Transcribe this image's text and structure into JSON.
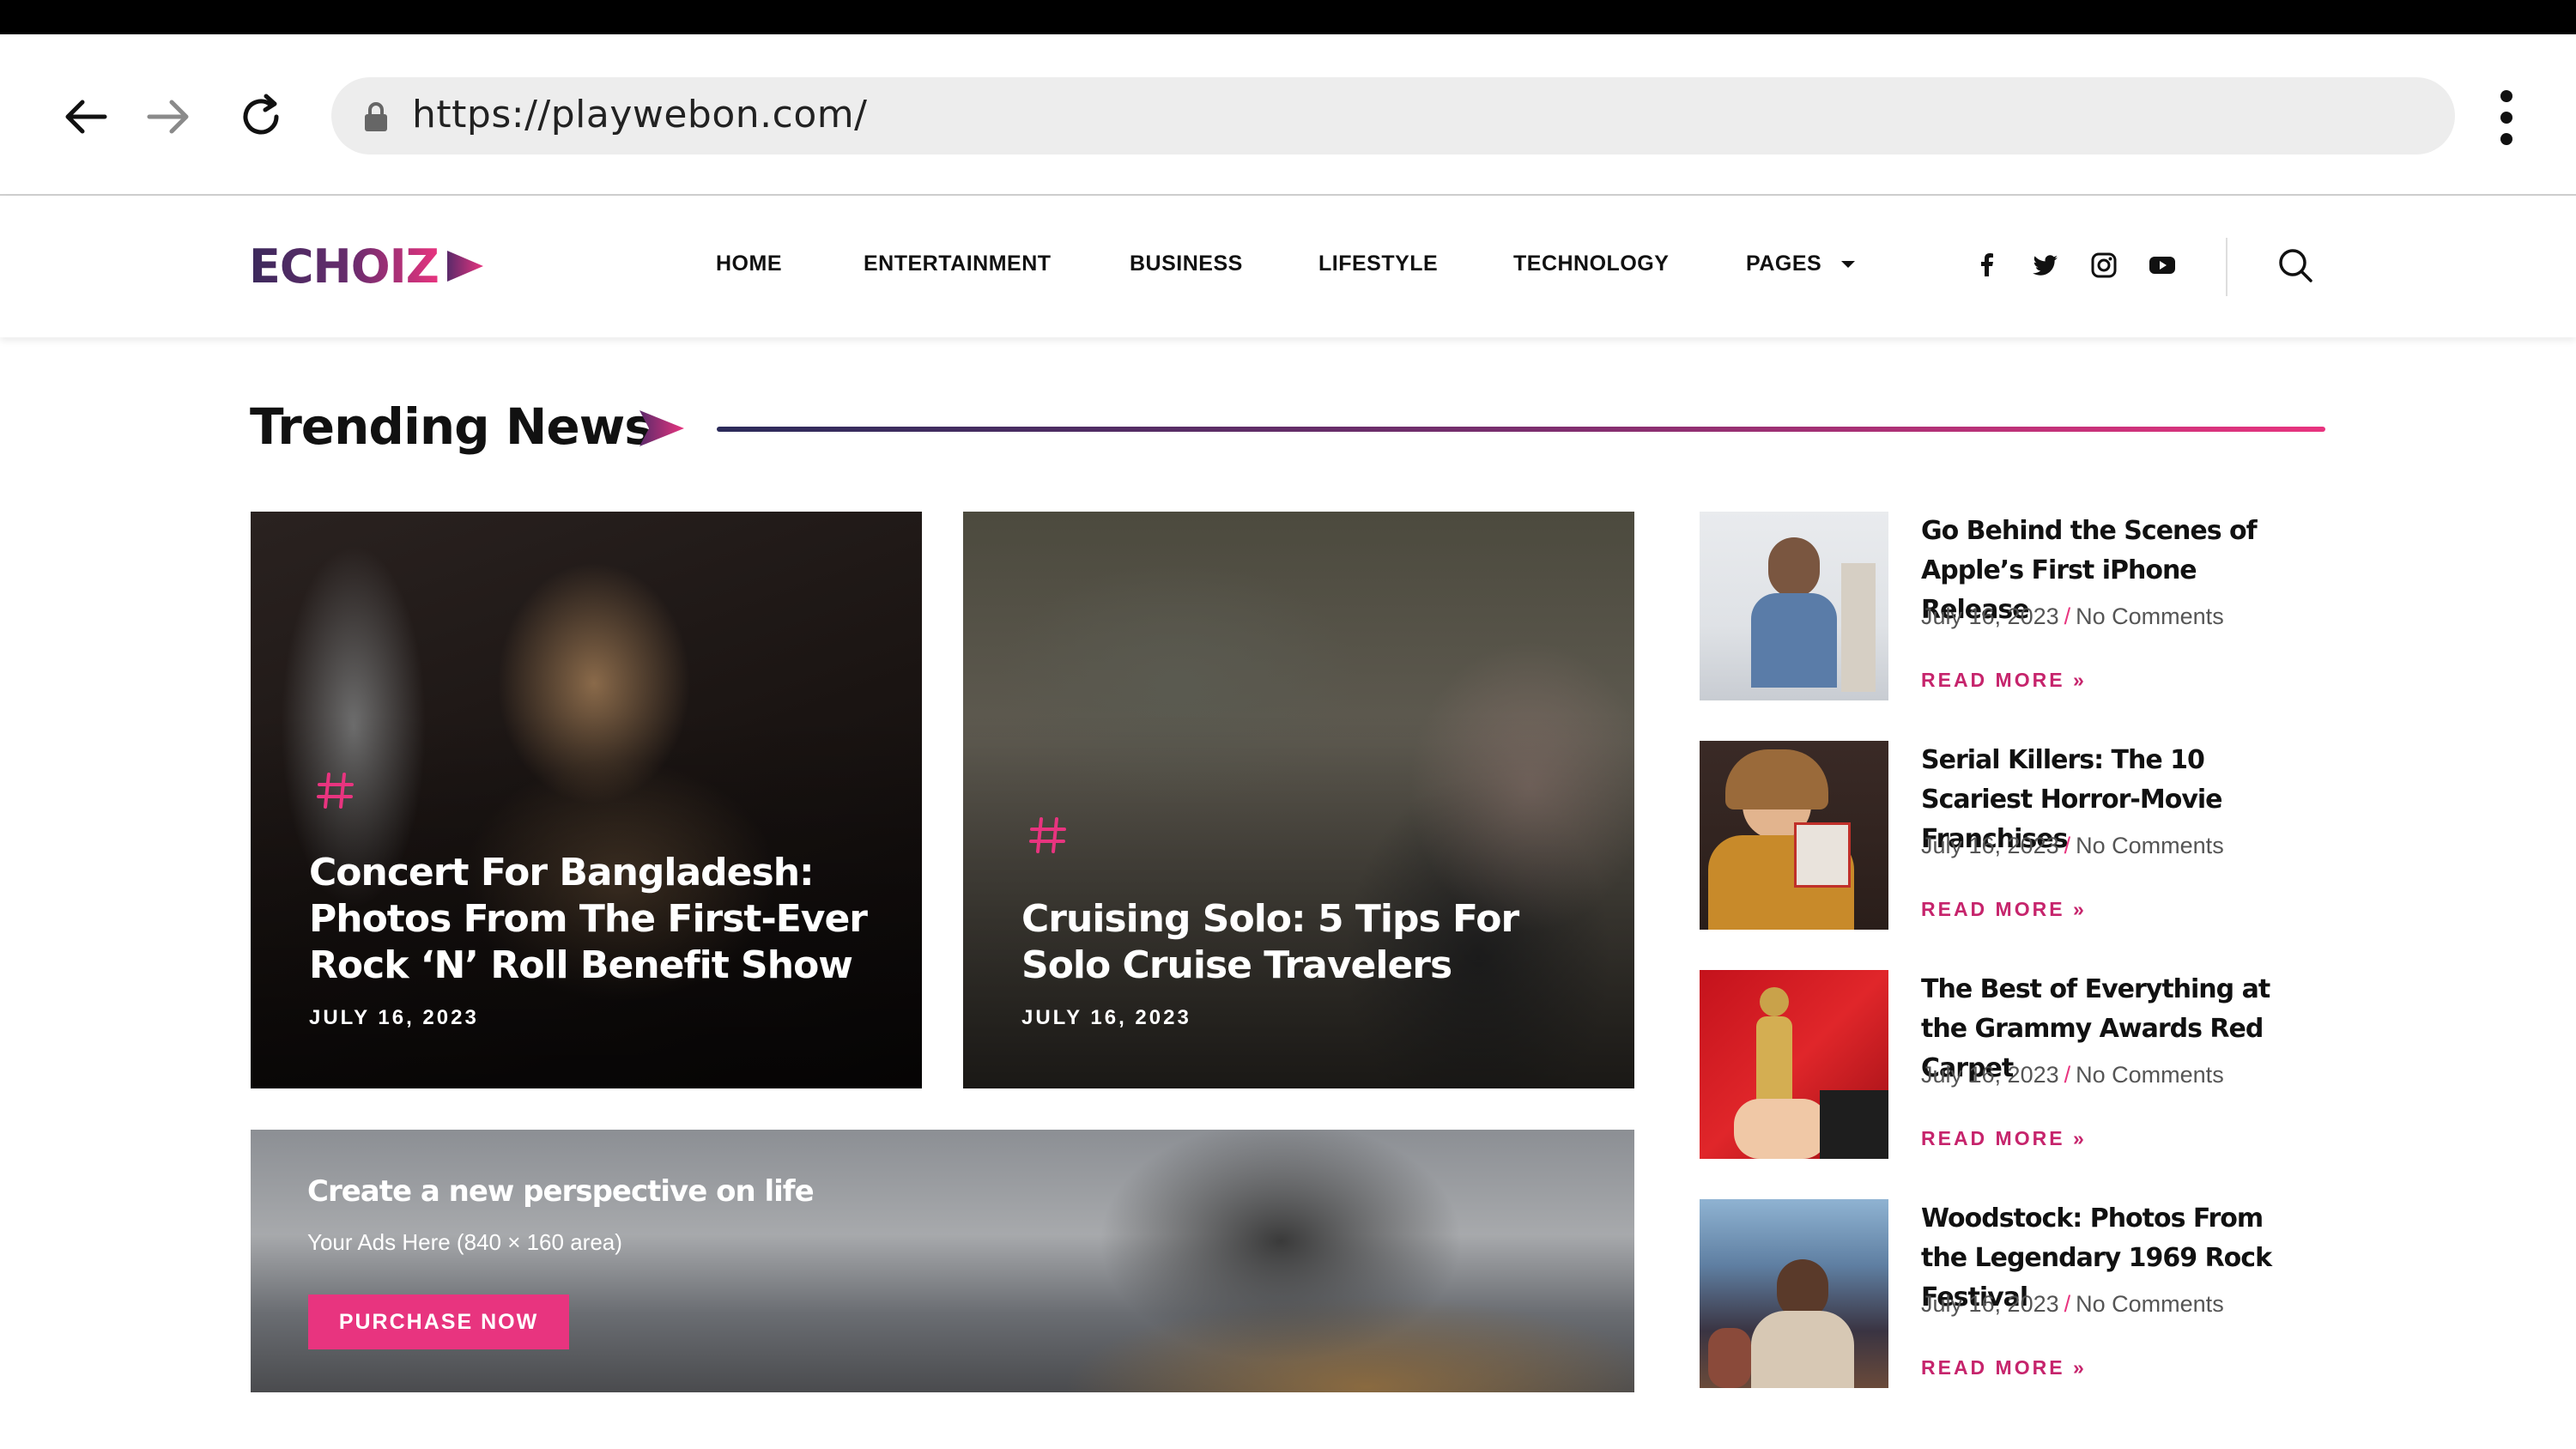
{
  "browser": {
    "url": "https://playwebon.com/"
  },
  "site": {
    "logo": "ECHOIZ",
    "nav": [
      "HOME",
      "ENTERTAINMENT",
      "BUSINESS",
      "LIFESTYLE",
      "TECHNOLOGY",
      "PAGES"
    ],
    "social_icons": [
      "facebook-icon",
      "twitter-icon",
      "instagram-icon",
      "youtube-icon"
    ],
    "accent_color": "#e8347f",
    "brand_dark": "#3b2a5c"
  },
  "trending": {
    "title": "Trending News",
    "cards": [
      {
        "title": "Concert For Bangladesh: Photos From The First-Ever Rock ‘N’ Roll Benefit Show",
        "date": "JULY 16, 2023"
      },
      {
        "title": "Cruising Solo: 5 Tips For Solo Cruise Travelers",
        "date": "JULY 16, 2023"
      }
    ],
    "ad": {
      "title": "Create a new perspective on life",
      "subtitle": "Your Ads Here (840 × 160 area)",
      "button": "PURCHASE NOW"
    },
    "side": [
      {
        "title": "Go Behind the Scenes of Apple’s First iPhone Release",
        "date": "July 16, 2023",
        "comments": "No Comments",
        "read_more": "READ MORE »"
      },
      {
        "title": "Serial Killers: The 10 Scariest Horror-Movie Franchises",
        "date": "July 16, 2023",
        "comments": "No Comments",
        "read_more": "READ MORE »"
      },
      {
        "title": "The Best of Everything at the Grammy Awards Red Carpet",
        "date": "July 16, 2023",
        "comments": "No Comments",
        "read_more": "READ MORE »"
      },
      {
        "title": "Woodstock: Photos From the Legendary 1969 Rock Festival",
        "date": "July 16, 2023",
        "comments": "No Comments",
        "read_more": "READ MORE »"
      }
    ]
  }
}
